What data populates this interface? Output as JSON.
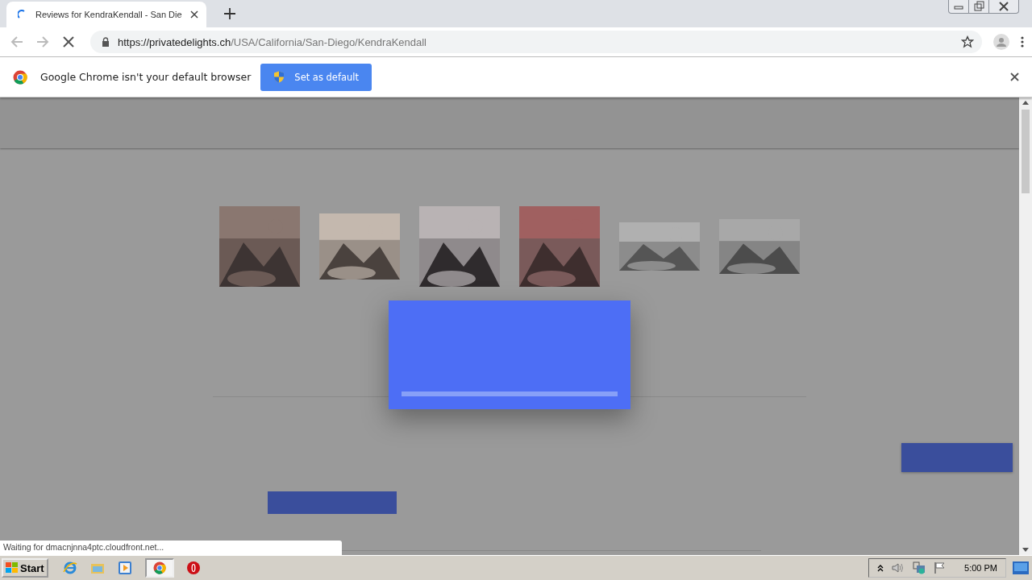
{
  "tab": {
    "title": "Reviews for KendraKendall - San Die",
    "loading": true
  },
  "address": {
    "host": "https://privatedelights.ch",
    "path": "/USA/California/San-Diego/KendraKendall"
  },
  "infobar": {
    "message": "Google Chrome isn't your default browser",
    "button": "Set as default"
  },
  "status_bubble": "Waiting for dmacnjnna4ptc.cloudfront.net...",
  "taskbar": {
    "start": "Start",
    "clock": "5:00 PM"
  }
}
